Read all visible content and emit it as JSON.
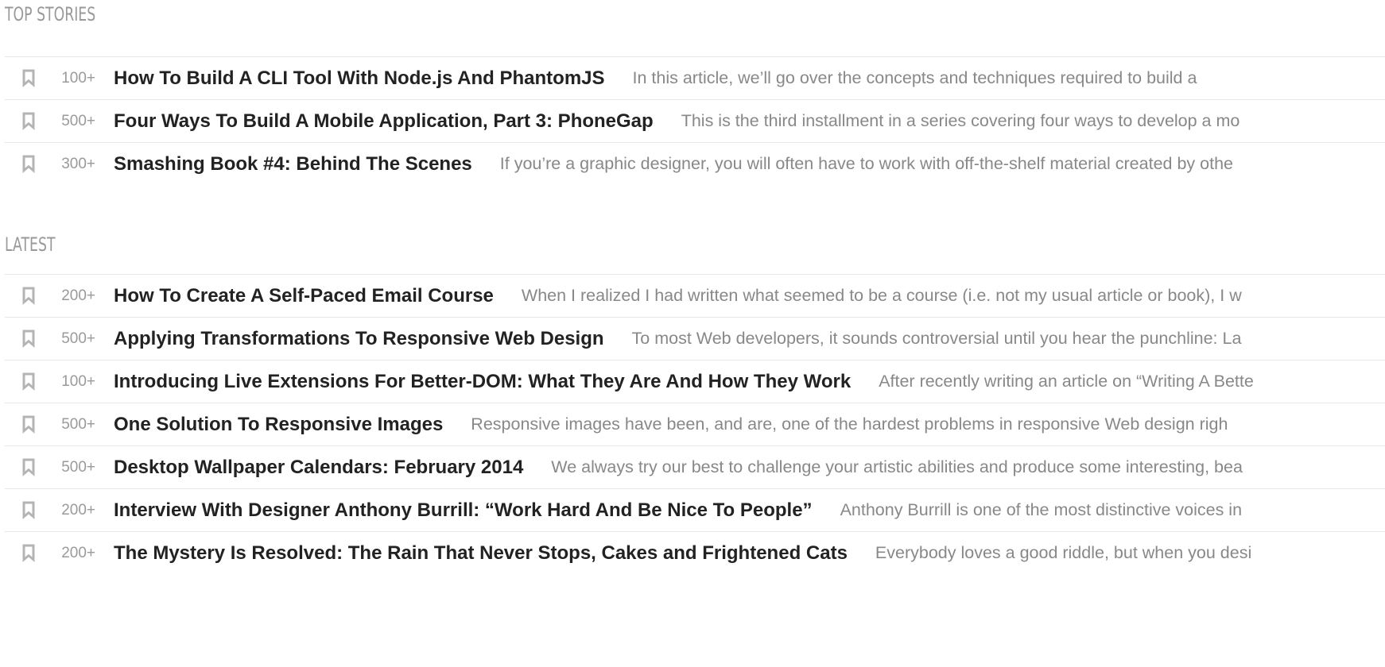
{
  "sections": [
    {
      "heading": "TOP STORIES",
      "items": [
        {
          "count": "100+",
          "title": "How To Build A CLI Tool With Node.js And PhantomJS",
          "excerpt": "In this article, we’ll go over the concepts and techniques required to build a"
        },
        {
          "count": "500+",
          "title": "Four Ways To Build A Mobile Application, Part 3: PhoneGap",
          "excerpt": "This is the third installment in a series covering four ways to develop a mo"
        },
        {
          "count": "300+",
          "title": "Smashing Book #4: Behind The Scenes",
          "excerpt": "If you’re a graphic designer, you will often have to work with off-the-shelf material created by othe"
        }
      ]
    },
    {
      "heading": "LATEST",
      "items": [
        {
          "count": "200+",
          "title": "How To Create A Self-Paced Email Course",
          "excerpt": "When I realized I had written what seemed to be a course (i.e. not my usual article or book), I w"
        },
        {
          "count": "500+",
          "title": "Applying Transformations To Responsive Web Design",
          "excerpt": "To most Web developers, it sounds controversial until you hear the punchline: La"
        },
        {
          "count": "100+",
          "title": "Introducing Live Extensions For Better-DOM: What They Are And How They Work",
          "excerpt": "After recently writing an article on “Writing A Bette"
        },
        {
          "count": "500+",
          "title": "One Solution To Responsive Images",
          "excerpt": "Responsive images have been, and are, one of the hardest problems in responsive Web design righ"
        },
        {
          "count": "500+",
          "title": "Desktop Wallpaper Calendars: February 2014",
          "excerpt": "We always try our best to challenge your artistic abilities and produce some interesting, bea"
        },
        {
          "count": "200+",
          "title": "Interview With Designer Anthony Burrill: “Work Hard And Be Nice To People”",
          "excerpt": "Anthony Burrill is one of the most distinctive voices in"
        },
        {
          "count": "200+",
          "title": "The Mystery Is Resolved: The Rain That Never Stops, Cakes and Frightened Cats",
          "excerpt": "Everybody loves a good riddle, but when you desi"
        }
      ]
    }
  ],
  "colors": {
    "bookmark_icon": "#b4b4b4",
    "title": "#222222",
    "count": "#9a9a9a",
    "excerpt": "#888888",
    "heading": "#999999",
    "divider": "#e6e6e6"
  },
  "icons": {
    "bookmark": "bookmark-icon"
  }
}
